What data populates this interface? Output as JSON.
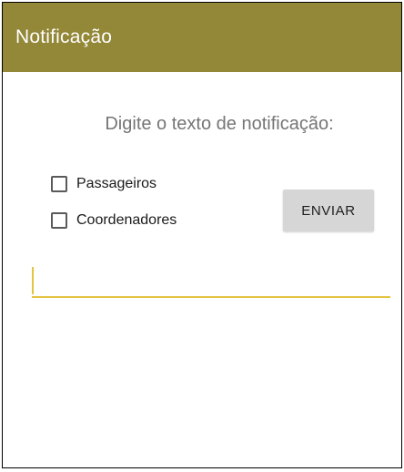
{
  "colors": {
    "appbar_bg": "#938738",
    "accent": "#E3C441"
  },
  "appbar": {
    "title": "Notificação"
  },
  "main": {
    "prompt": "Digite o texto de notificação:",
    "checkboxes": [
      {
        "label": "Passageiros",
        "checked": false
      },
      {
        "label": "Coordenadores",
        "checked": false
      }
    ],
    "send_label": "ENVIAR",
    "message_input": {
      "value": "",
      "placeholder": ""
    }
  }
}
